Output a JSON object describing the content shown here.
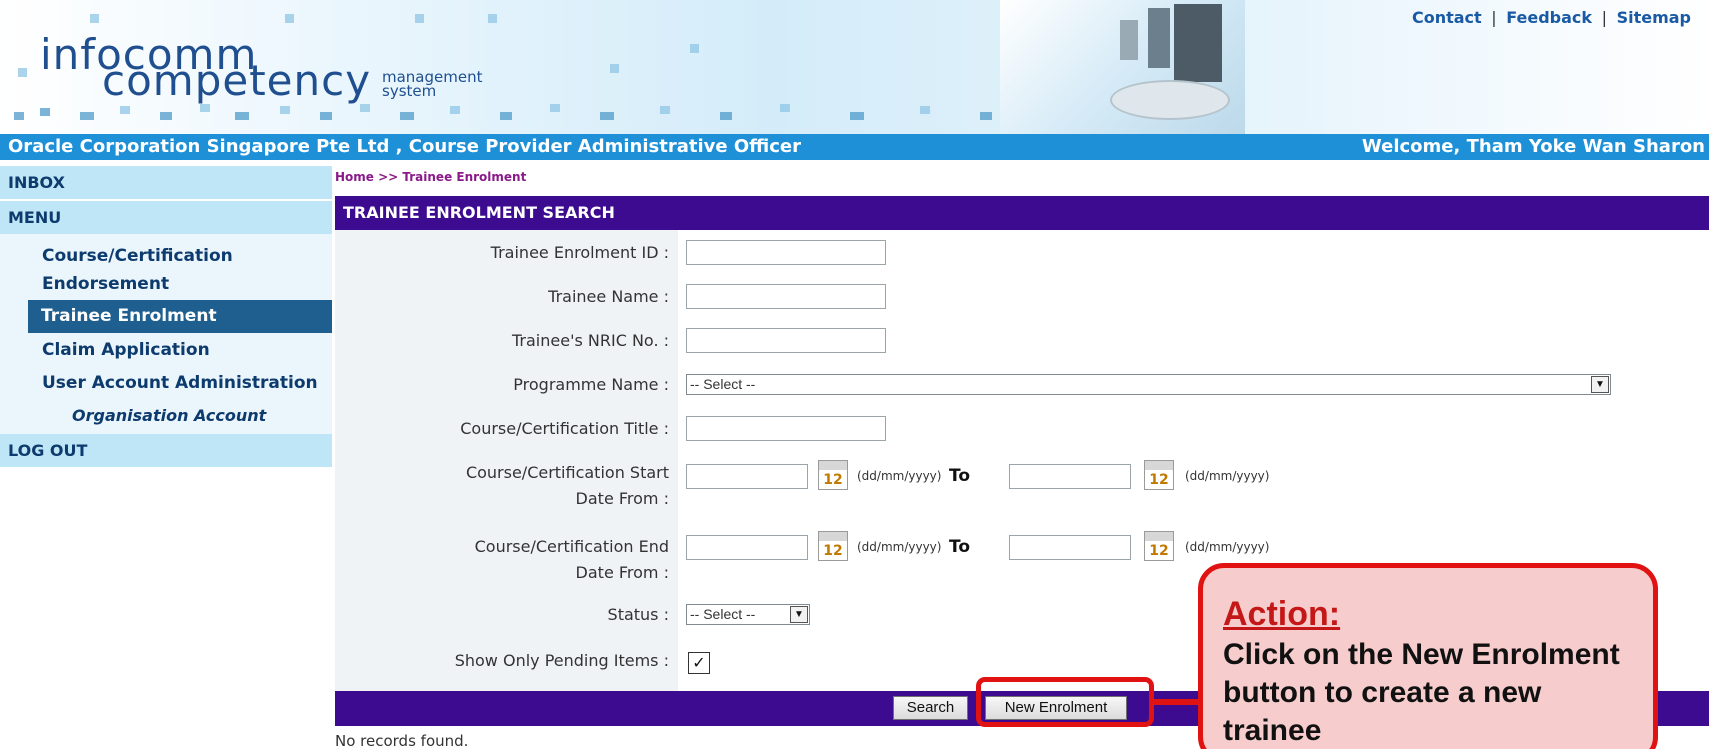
{
  "header": {
    "logo_line1": "infocomm",
    "logo_line2": "competency",
    "logo_line3a": "management",
    "logo_line3b": "system",
    "links": [
      "Contact",
      "Feedback",
      "Sitemap"
    ],
    "link_separator": "|",
    "organisation": "Oracle Corporation Singapore Pte Ltd , Course Provider Administrative Officer",
    "welcome": "Welcome, Tham Yoke Wan Sharon"
  },
  "sidebar": {
    "inbox": "INBOX",
    "menu": "MENU",
    "items": [
      {
        "label_1": "Course/Certification",
        "label_2": "Endorsement"
      },
      {
        "label": "Trainee Enrolment"
      },
      {
        "label": "Claim Application"
      },
      {
        "label": "User Account Administration"
      }
    ],
    "subitem": "Organisation Account",
    "logout": "LOG OUT"
  },
  "breadcrumb": "Home >>  Trainee Enrolment",
  "panel": {
    "title": "TRAINEE ENROLMENT SEARCH"
  },
  "form": {
    "enrolment_id_label": "Trainee Enrolment ID :",
    "name_label": "Trainee Name :",
    "nric_label": "Trainee's NRIC No. :",
    "programme_label": "Programme Name :",
    "programme_value": "-- Select --",
    "course_title_label": "Course/Certification Title :",
    "start_label_1": "Course/Certification Start",
    "start_label_2": "Date From :",
    "end_label_1": "Course/Certification End",
    "end_label_2": "Date From :",
    "date_hint": "(dd/mm/yyyy)",
    "to_label": "To",
    "calendar_number": "12",
    "status_label": "Status :",
    "status_value": "-- Select --",
    "pending_label": "Show Only Pending Items :",
    "pending_mark": "✓",
    "dropdown_arrow": "▼"
  },
  "buttons": {
    "search": "Search",
    "new_enrolment": "New Enrolment"
  },
  "results": {
    "message": "No records found."
  },
  "callout": {
    "heading": "Action:",
    "text": "Click on the New Enrolment button to create a new trainee"
  },
  "colors": {
    "header_bar": "#1e90d8",
    "panel_bar": "#3d0b8f",
    "sidebar_active": "#1f5f8f",
    "highlight": "#e01212",
    "callout_bg": "#f6cccc"
  }
}
